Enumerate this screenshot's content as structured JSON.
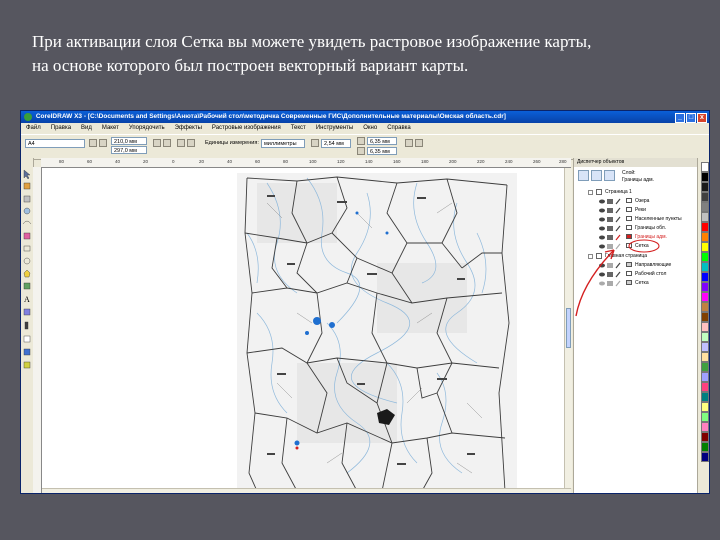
{
  "slide": {
    "line1": "При активации слоя Сетка вы можете увидеть растровое изображение карты,",
    "line2": "на основе которого был построен векторный вариант карты."
  },
  "window": {
    "title": "CorelDRAW X3 - [C:\\Documents and Settings\\Анюта\\Рабочий стол\\методичка Современные ГИС\\Дополнительные материалы\\Омская область.cdr]",
    "buttons": [
      "_",
      "□",
      "x"
    ]
  },
  "menu": [
    "Файл",
    "Правка",
    "Вид",
    "Макет",
    "Упорядочить",
    "Эффекты",
    "Растровые изображения",
    "Текст",
    "Инструменты",
    "Окно",
    "Справка"
  ],
  "propbar": {
    "paper": "A4",
    "width": "210,0 мм",
    "height": "297,0 мм",
    "units_label": "Единицы измерения:",
    "units": "миллиметры",
    "nudge": "2,54 мм",
    "dup_x": "6,35 мм",
    "dup_y": "6,35 мм"
  },
  "ruler": {
    "top_ticks": [
      "80",
      "60",
      "40",
      "20",
      "0",
      "20",
      "40",
      "60",
      "80",
      "100",
      "120",
      "140",
      "160",
      "180",
      "200",
      "220",
      "240",
      "260",
      "280"
    ]
  },
  "docker": {
    "title": "Диспетчер объектов",
    "layer_caption": "Слой:",
    "layer_name": "Границы адм.",
    "tree": [
      {
        "label": "Страница 1",
        "level": 0,
        "swatch": ""
      },
      {
        "label": "Озера",
        "level": 1,
        "swatch": "#1a1a1a"
      },
      {
        "label": "Реки",
        "level": 1,
        "swatch": "#1a1a1a"
      },
      {
        "label": "Населенные пункты",
        "level": 1,
        "swatch": "#1a1a1a"
      },
      {
        "label": "Границы обл.",
        "level": 1,
        "swatch": "#1a1a1a"
      },
      {
        "label": "Границы адм.",
        "level": 1,
        "swatch": "#d42020"
      },
      {
        "label": "Сетка",
        "level": 1,
        "swatch": "#1a1a1a"
      },
      {
        "label": "Главная страница",
        "level": 0,
        "swatch": ""
      },
      {
        "label": "Направляющие",
        "level": 1,
        "swatch": "#cfcfcf"
      },
      {
        "label": "Рабочий стол",
        "level": 1,
        "swatch": "#1a1a1a"
      },
      {
        "label": "Сетка",
        "level": 1,
        "swatch": "#cfcfcf"
      }
    ]
  },
  "palette": [
    "#ffffff",
    "#000000",
    "#1a1a1a",
    "#404040",
    "#808080",
    "#c0c0c0",
    "#ff0000",
    "#ff8000",
    "#ffff00",
    "#00ff00",
    "#00c0c0",
    "#0000ff",
    "#8000ff",
    "#ff00ff",
    "#c08040",
    "#804000",
    "#ffc0c0",
    "#c0ffc0",
    "#c0c0ff",
    "#ffe0a0",
    "#40a040",
    "#a0a0ff",
    "#ff4080",
    "#008080",
    "#ffff80",
    "#80ff80",
    "#ff80c0",
    "#800000",
    "#008000",
    "#000080"
  ],
  "colors": {
    "slide_bg": "#56565f",
    "titlebar": "#0a5fd8",
    "annotation_red": "#d42020"
  }
}
